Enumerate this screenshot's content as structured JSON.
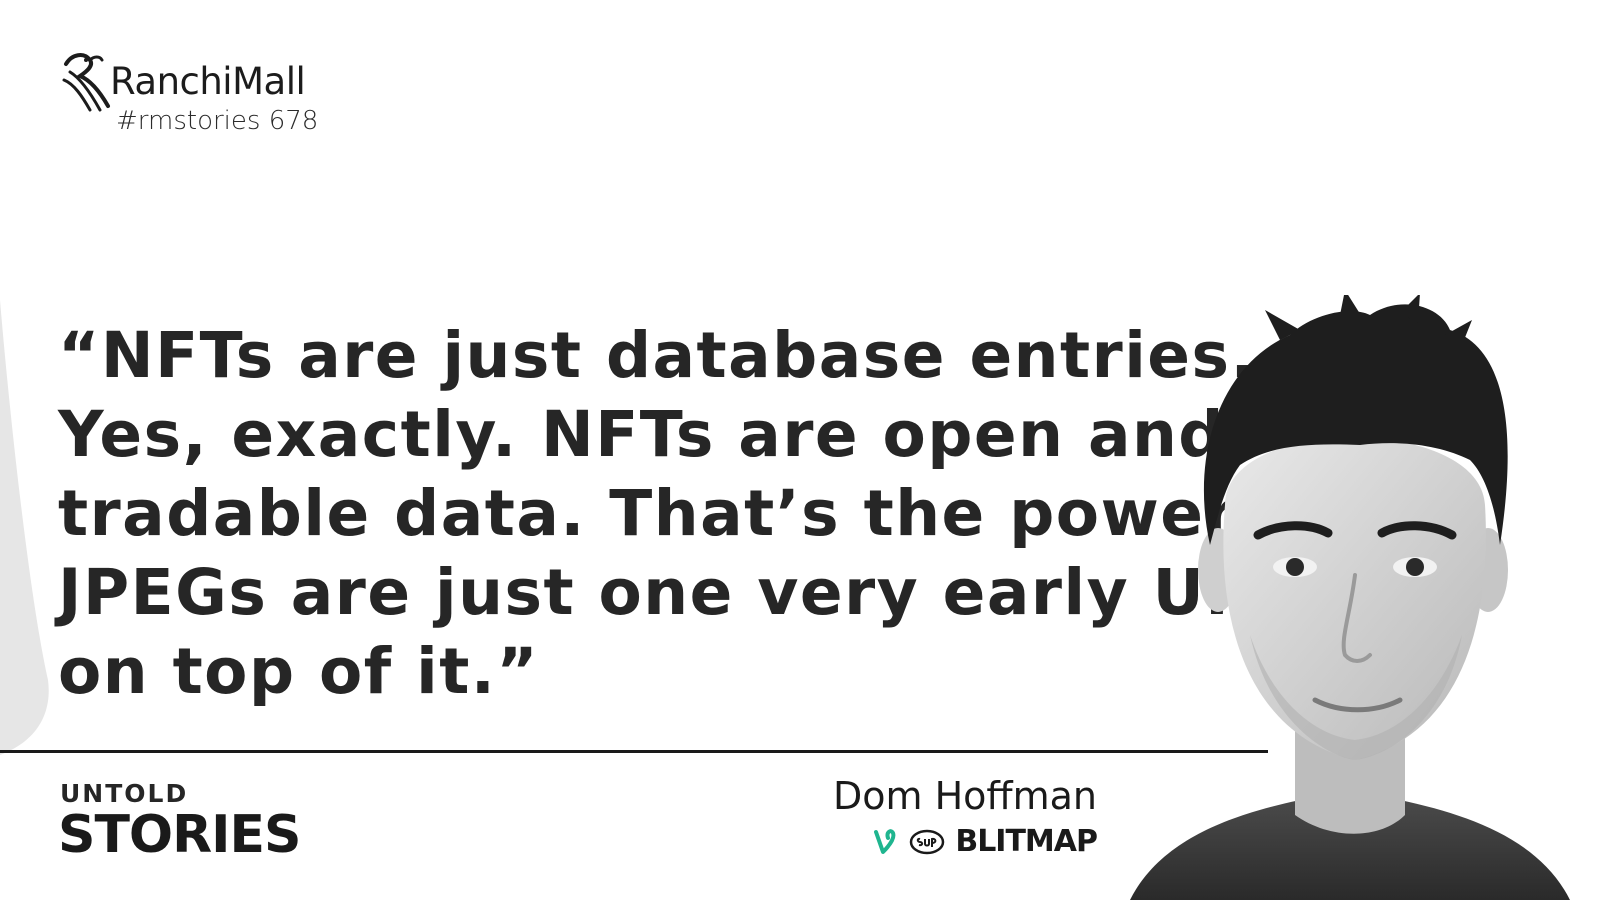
{
  "brand": {
    "name": "RanchiMall",
    "tag": "#rmstories 678"
  },
  "quote": {
    "lines": [
      "“NFTs are just database entries.",
      "Yes, exactly. NFTs are open and",
      "tradable data. That’s the power.",
      "JPEGs are just one very early UI",
      "on top of it.”"
    ]
  },
  "series": {
    "top": "UNTOLD",
    "bottom": "STORIES"
  },
  "speaker": {
    "name": "Dom Hoffman",
    "brands": {
      "vine_icon": "vine-icon",
      "sup_icon": "sup-icon",
      "blitmap": "BLITMAP"
    }
  },
  "colors": {
    "text": "#262626",
    "accent_gray": "#e6e6e6",
    "vine_green": "#1fb58f"
  }
}
